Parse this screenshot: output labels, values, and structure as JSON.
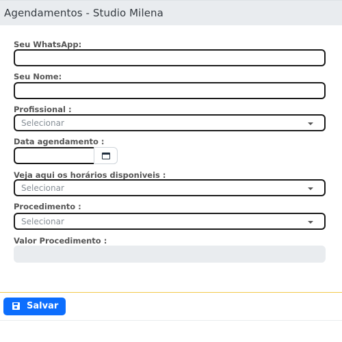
{
  "header": {
    "title": "Agendamentos - Studio Milena"
  },
  "form": {
    "whatsapp": {
      "label": "Seu WhatsApp:",
      "value": ""
    },
    "nome": {
      "label": "Seu Nome:",
      "value": ""
    },
    "profissional": {
      "label": "Profissional :",
      "value": "Selecionar"
    },
    "data": {
      "label": "Data agendamento :",
      "value": "",
      "icon": "calendar-icon"
    },
    "horarios": {
      "label": "Veja aqui os horários disponiveis :",
      "value": "Selecionar"
    },
    "procedimento": {
      "label": "Procedimento :",
      "value": "Selecionar"
    },
    "valor": {
      "label": "Valor Procedimento :",
      "value": ""
    }
  },
  "footer": {
    "save_label": "Salvar",
    "save_icon": "floppy-disk-icon",
    "accent": "#0d6efd",
    "divider_color": "#f3c94a"
  }
}
